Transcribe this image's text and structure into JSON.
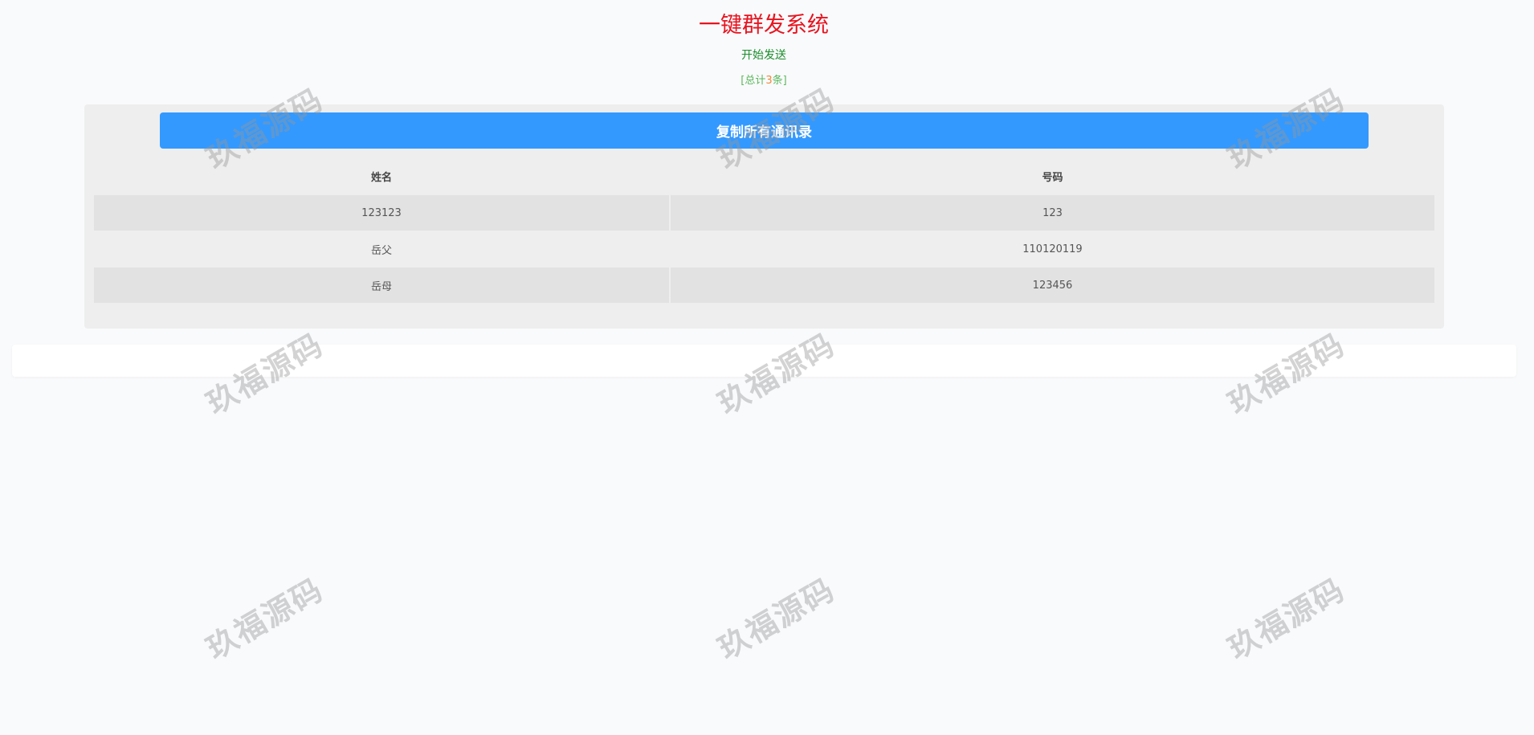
{
  "header": {
    "title": "一键群发系统",
    "status": "开始发送",
    "count_prefix": "[总计",
    "count_value": "3",
    "count_suffix": "条]"
  },
  "toolbar": {
    "copy_all_label": "复制所有通讯录"
  },
  "contacts": {
    "columns": [
      "姓名",
      "号码"
    ],
    "rows": [
      {
        "name": "123123",
        "number": "123"
      },
      {
        "name": "岳父",
        "number": "110120119"
      },
      {
        "name": "岳母",
        "number": "123456"
      }
    ]
  },
  "watermark": {
    "text": "玖福源码"
  },
  "colors": {
    "title": "#e8141f",
    "status": "#1a8d2b",
    "count": "#5cb85c",
    "count_number": "#f0883a",
    "button": "#3399ff"
  }
}
